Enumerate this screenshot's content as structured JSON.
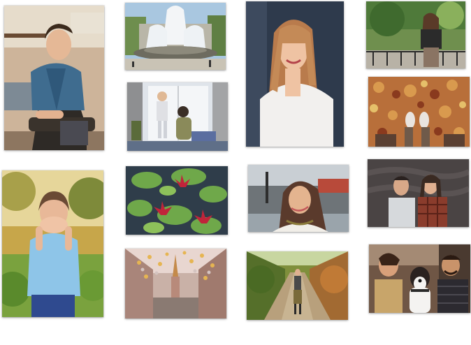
{
  "gallery": {
    "prints": [
      {
        "name": "man-in-plaid-shirt-on-chair",
        "bg": "#cdb49a",
        "accent": "#3f6c8f"
      },
      {
        "name": "city-fountain",
        "bg": "#a9c7e0",
        "accent": "#6d6b5f"
      },
      {
        "name": "smiling-woman-white-tshirt",
        "bg": "#2e3a4c",
        "accent": "#f2f0ee"
      },
      {
        "name": "woman-in-park-by-railing",
        "bg": "#6f8f4e",
        "accent": "#8a7463"
      },
      {
        "name": "children-at-window",
        "bg": "#dfe4ea",
        "accent": "#5a6b3a"
      },
      {
        "name": "autumn-leaves-feet",
        "bg": "#b86f3a",
        "accent": "#e9e4df"
      },
      {
        "name": "woman-covering-mouth",
        "bg": "#c7a64a",
        "accent": "#8ec5e8"
      },
      {
        "name": "water-lilies-pond",
        "bg": "#3f6f45",
        "accent": "#c0243a"
      },
      {
        "name": "woman-smiling-city-street",
        "bg": "#9aa4ab",
        "accent": "#5a3a2c"
      },
      {
        "name": "couple-portrait-dark-wall",
        "bg": "#4a4444",
        "accent": "#8a3c2c"
      },
      {
        "name": "decorated-street-with-spire",
        "bg": "#c9b1a7",
        "accent": "#e6b552"
      },
      {
        "name": "woman-on-tree-alley",
        "bg": "#7f8f3c",
        "accent": "#b8a07c"
      },
      {
        "name": "couple-with-dog",
        "bg": "#6f5645",
        "accent": "#f4f3f1"
      }
    ]
  }
}
